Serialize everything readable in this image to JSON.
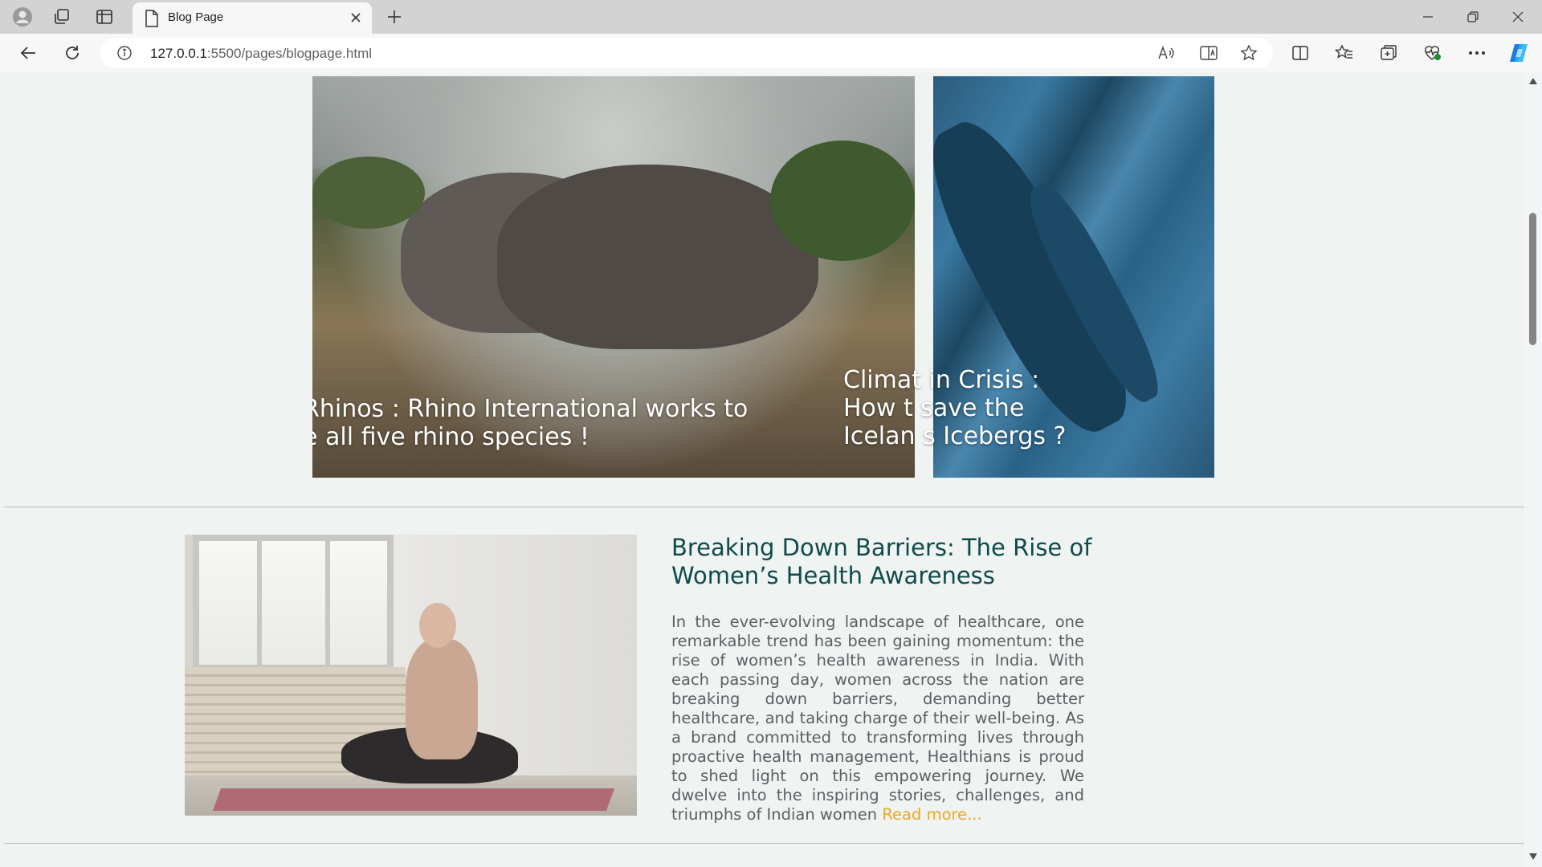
{
  "browser": {
    "tab_title": "Blog Page",
    "url_host": "127.0.0.1",
    "url_path": ":5500/pages/blogpage.html"
  },
  "cards": [
    {
      "caption_line1": "Rhinos : Rhino International works to",
      "caption_line2": "e all five rhino species !"
    },
    {
      "caption_line1": "Climat  in Crisis :",
      "caption_line2": "How t  save the",
      "caption_line3": "Icelan  s Icebergs ?"
    }
  ],
  "post": {
    "title": "Breaking Down Barriers: The Rise of Women’s Health Awareness",
    "body": "In the ever-evolving landscape of healthcare, one remarkable trend has been gaining momentum: the rise of women’s health awareness in India. With each passing day, women across the nation are breaking down barriers, demanding better healthcare, and taking charge of their well-being. As a brand committed to transforming lives through proactive health management, Healthians is proud to shed light on this empowering journey. We dwelve into the inspiring stories, challenges, and triumphs of Indian women ",
    "read_more": "Read more..."
  },
  "colors": {
    "accent": "#f0a51f",
    "title": "#0f4a4a",
    "page_background": "#eff4f2"
  },
  "icons": {
    "profile": "profile-icon",
    "collections": "workspaces-icon",
    "vertical_tabs": "tab-actions-icon",
    "back": "back-arrow-icon",
    "refresh": "refresh-icon",
    "site_info": "info-icon",
    "read_aloud": "read-aloud-icon",
    "immersive_reader": "immersive-reader-icon",
    "favorite": "star-icon",
    "split_screen": "split-screen-icon",
    "favorites": "favorites-icon",
    "collections_btn": "collections-icon",
    "performance": "heartbeat-icon",
    "more": "more-icon",
    "copilot": "copilot-icon"
  }
}
